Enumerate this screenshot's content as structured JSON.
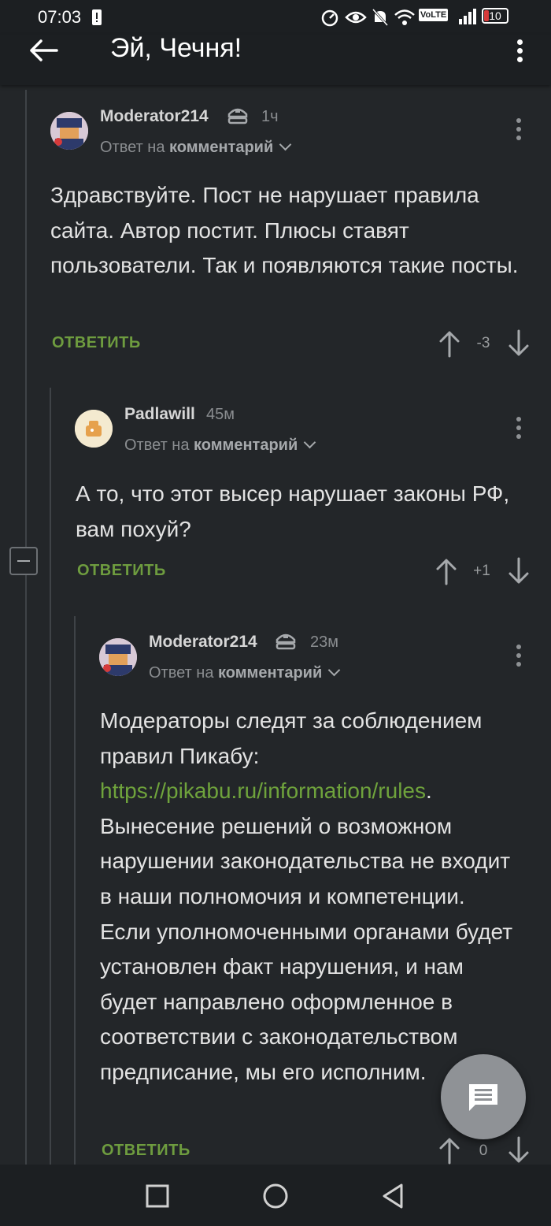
{
  "status_bar": {
    "time": "07:03",
    "battery": "10",
    "volte": "VoLTE"
  },
  "app_bar": {
    "title": "Эй, Чечня!"
  },
  "comments": [
    {
      "author": "Moderator214",
      "time": "1ч",
      "reply_prefix": "Ответ на",
      "reply_target": "комментарий",
      "text": "Здравствуйте. Пост не нарушает правила сайта. Автор постит. Плюсы ставят пользователи. Так и появляются такие посты.",
      "reply_label": "ОТВЕТИТЬ",
      "score": "-3"
    },
    {
      "author": "Padlawill",
      "time": "45м",
      "reply_prefix": "Ответ на",
      "reply_target": "комментарий",
      "text": "А то, что этот высер нарушает законы РФ, вам похуй?",
      "reply_label": "ОТВЕТИТЬ",
      "score": "+1"
    },
    {
      "author": "Moderator214",
      "time": "23м",
      "reply_prefix": "Ответ на",
      "reply_target": "комментарий",
      "text_before_link": "Модераторы следят за соблюдением правил Пикабу: ",
      "link": "https://pikabu.ru/information/rules",
      "text_after_link": ". Вынесение решений о возможном нарушении законодательства не входит в наши полномочия и компетенции. Если уполномоченными органами будет установлен факт нарушения, и нам будет направлено оформленное в соответствии с законодательством предписание, мы его исполним.",
      "reply_label": "ОТВЕТИТЬ",
      "score": "0"
    }
  ],
  "icons": {
    "back": "arrow-left-icon",
    "more": "more-vertical-icon",
    "moderator_badge": "moderator-cap-icon",
    "upvote": "arrow-up-icon",
    "downvote": "arrow-down-icon",
    "fab": "comment-icon",
    "collapse": "minus-icon"
  },
  "colors": {
    "background": "#232629",
    "accent_green": "#6e9c3f",
    "link_green": "#6fa33c"
  }
}
